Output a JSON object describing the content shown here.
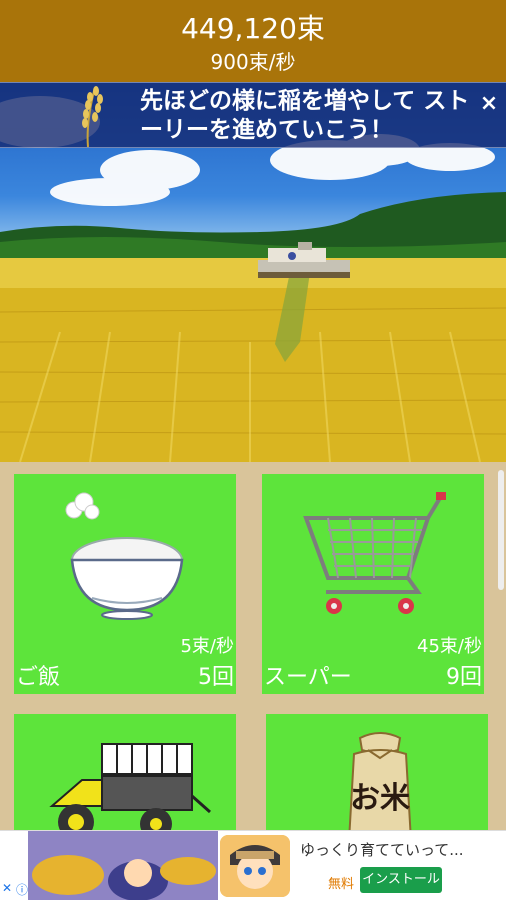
{
  "header": {
    "total": "449,120束",
    "rate": "900束/秒"
  },
  "banner": {
    "message": "先ほどの様に稲を増やして ストーリーを進めていこう！",
    "close": "×"
  },
  "cards": [
    {
      "id": "rice",
      "name": "ご飯",
      "rate": "5束/秒",
      "count": "5回",
      "icon": "rice-bowl-icon"
    },
    {
      "id": "super",
      "name": "スーパー",
      "rate": "45束/秒",
      "count": "9回",
      "icon": "shopping-cart-icon"
    },
    {
      "id": "planter",
      "name": "",
      "rate": "",
      "count": "",
      "icon": "rice-planter-icon"
    },
    {
      "id": "rice-bag",
      "name": "",
      "rate": "",
      "count": "",
      "icon": "rice-bag-icon",
      "label": "お米"
    }
  ],
  "ad": {
    "title": "ゆっくり育てていって...",
    "free": "無料",
    "install": "インストール"
  },
  "colors": {
    "header": "#a9740a",
    "card": "#5de43b",
    "grid_bg": "#d9c49a",
    "install": "#1a9e4b"
  }
}
